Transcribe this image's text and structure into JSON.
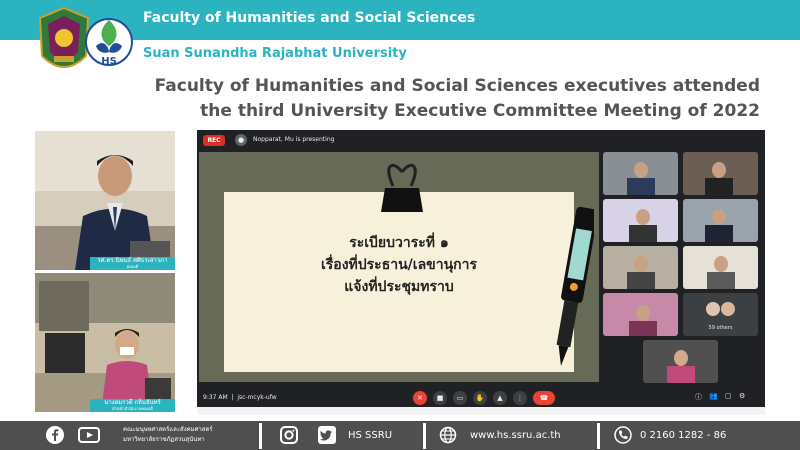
{
  "header": {
    "faculty_name": "Faculty of Humanities and Social Sciences",
    "university_name": "Suan Sunandha Rajabhat University",
    "logo2_text": "HS"
  },
  "headline": {
    "line1": "Faculty of Humanities and Social Sciences executives attended",
    "line2": "the third University Executive Committee Meeting of 2022"
  },
  "photos": [
    {
      "caption_name": "รศ.ดร.นิพนธ์ ศศิธรเสาวภา",
      "caption_role": "คณบดี"
    },
    {
      "caption_name": "นางอมรวดี กลิ่นจันทร์",
      "caption_role": "หัวหน้าสำนักงานคณบดี"
    }
  ],
  "meeting": {
    "rec_label": "REC",
    "presenting_text": "Nopparat, Mu is presenting",
    "slide_lines": [
      "ระเบียบวาระที่ ๑",
      "เรื่องที่ประธาน/เลขานุการ",
      "แจ้งที่ประชุมทราบ"
    ],
    "others_label": "59 others",
    "time": "9:37 AM",
    "meeting_code": "jsc-mcyk-ufw",
    "tile_names": [
      "",
      "",
      "",
      "",
      "",
      "",
      "",
      "",
      ""
    ]
  },
  "footer": {
    "thai_line1": "คณะมนุษยศาสตร์และสังคมศาสตร์",
    "thai_line2": "มหาวิทยาลัยราชภัฏสวนสุนันทา",
    "social_label": "HS SSRU",
    "website": "www.hs.ssru.ac.th",
    "phone": "0 2160 1282 - 86"
  },
  "colors": {
    "accent": "#2bb3c0",
    "footer_bg": "#4f4f4f",
    "headline": "#555555"
  }
}
